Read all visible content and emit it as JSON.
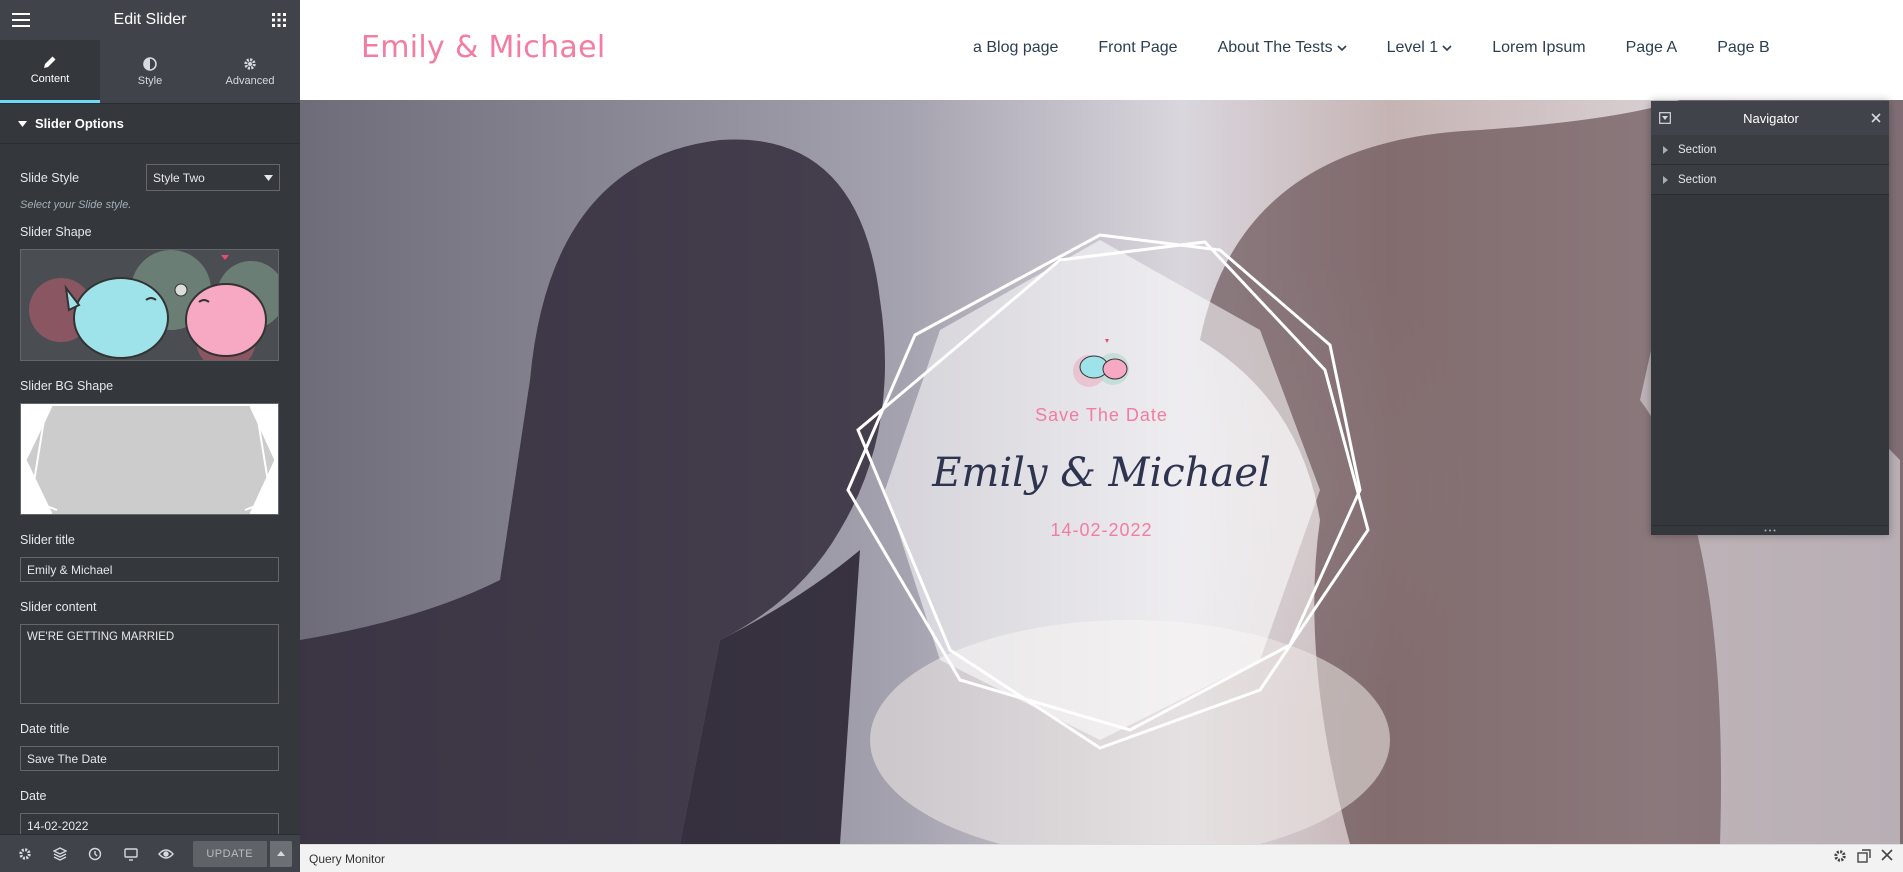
{
  "editor": {
    "title": "Edit Slider",
    "tabs": [
      {
        "label": "Content",
        "icon": "pencil-icon"
      },
      {
        "label": "Style",
        "icon": "half-circle-icon"
      },
      {
        "label": "Advanced",
        "icon": "gear-icon"
      }
    ],
    "section_title": "Slider Options",
    "slide_style_label": "Slide Style",
    "slide_style_value": "Style Two",
    "slide_style_help": "Select your Slide style.",
    "slider_shape_label": "Slider Shape",
    "slider_bg_shape_label": "Slider BG Shape",
    "slider_title_label": "Slider title",
    "slider_title_value": "Emily & Michael",
    "slider_content_label": "Slider content",
    "slider_content_value": "WE'RE GETTING MARRIED",
    "date_title_label": "Date title",
    "date_title_value": "Save The Date",
    "date_label": "Date",
    "date_value": "14-02-2022",
    "update_label": "UPDATE"
  },
  "site": {
    "logo": "Emily & Michael",
    "nav": [
      {
        "label": "a Blog page",
        "dropdown": false
      },
      {
        "label": "Front Page",
        "dropdown": false
      },
      {
        "label": "About The Tests",
        "dropdown": true
      },
      {
        "label": "Level 1",
        "dropdown": true
      },
      {
        "label": "Lorem Ipsum",
        "dropdown": false
      },
      {
        "label": "Page A",
        "dropdown": false
      },
      {
        "label": "Page B",
        "dropdown": false
      }
    ]
  },
  "hero": {
    "date_title": "Save The Date",
    "couple": "Emily & Michael",
    "date": "14-02-2022"
  },
  "navigator": {
    "title": "Navigator",
    "items": [
      "Section",
      "Section"
    ]
  },
  "query_monitor": {
    "label": "Query Monitor"
  },
  "colors": {
    "accent_pink": "#f47ca0",
    "panel_dark": "#34383c",
    "active_tab": "#71d7f7",
    "title_navy": "#2e3450"
  }
}
